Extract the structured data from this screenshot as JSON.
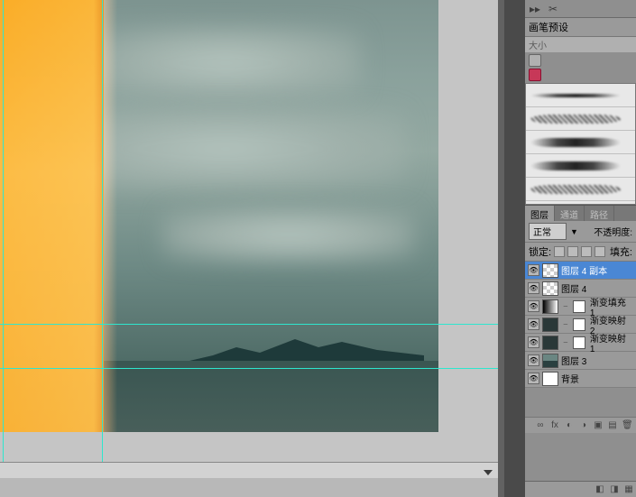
{
  "brush_panel": {
    "header": "画笔预设",
    "sub": "大小"
  },
  "layers_panel": {
    "tabs": [
      "图层",
      "通道",
      "路径"
    ],
    "blend_label": "正常",
    "opacity_label": "不透明度:",
    "lock_label": "锁定:",
    "fill_label": "填充:",
    "layers": [
      {
        "name": "图层 4 副本",
        "selected": true,
        "thumb": "checker"
      },
      {
        "name": "图层 4",
        "selected": false,
        "thumb": "checker"
      },
      {
        "name": "渐变填充 1",
        "selected": false,
        "thumb": "grad",
        "mask": true
      },
      {
        "name": "渐变映射 2",
        "selected": false,
        "thumb": "dark",
        "mask": true
      },
      {
        "name": "渐变映射 1",
        "selected": false,
        "thumb": "dark",
        "mask": true
      },
      {
        "name": "图层 3",
        "selected": false,
        "thumb": "img"
      },
      {
        "name": "背景",
        "selected": false,
        "thumb": "white"
      }
    ]
  }
}
